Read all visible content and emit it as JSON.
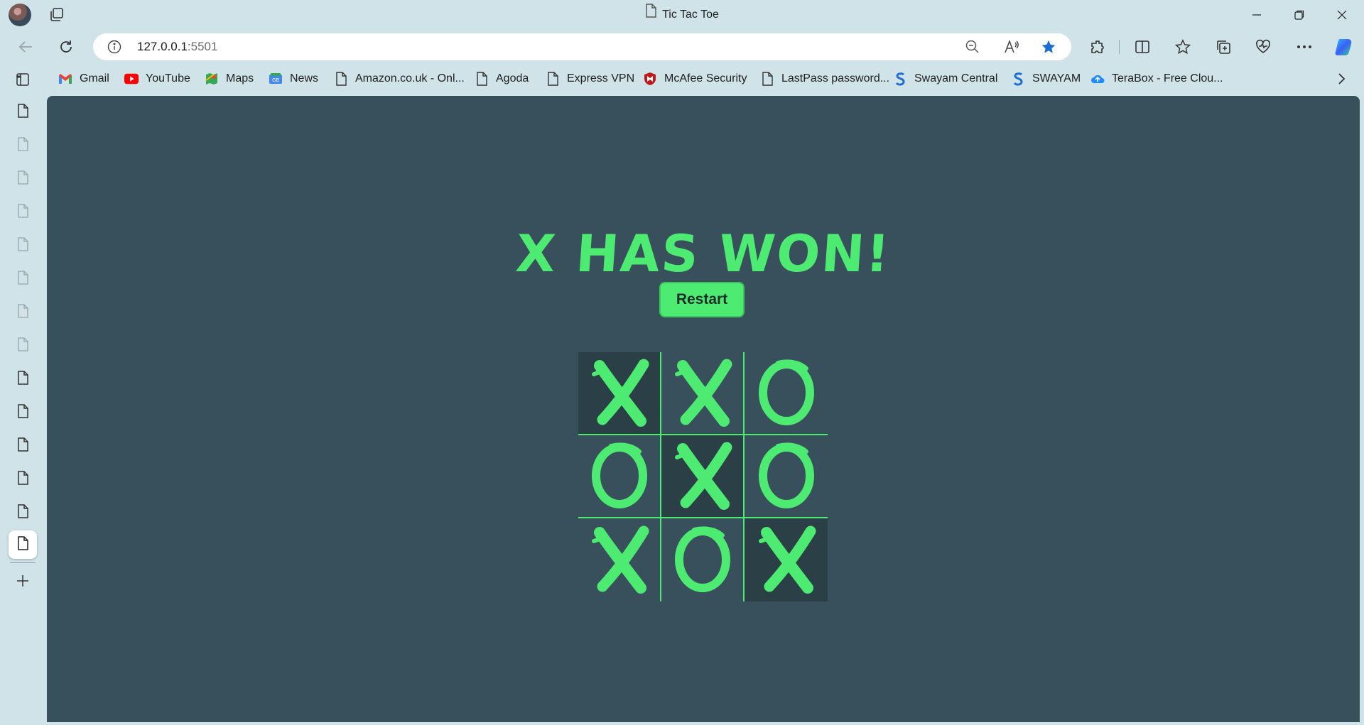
{
  "window": {
    "title": "Tic Tac Toe",
    "controls": [
      "minimize",
      "restore",
      "close"
    ]
  },
  "toolbar": {
    "address_host": "127.0.0.1",
    "address_port": ":5501"
  },
  "bookmarks": [
    {
      "label": "Gmail",
      "icon": "gmail-icon"
    },
    {
      "label": "YouTube",
      "icon": "youtube-icon"
    },
    {
      "label": "Maps",
      "icon": "maps-icon"
    },
    {
      "label": "News",
      "icon": "news-icon"
    },
    {
      "label": "Amazon.co.uk - Onl...",
      "icon": "page-icon"
    },
    {
      "label": "Agoda",
      "icon": "page-icon"
    },
    {
      "label": "Express VPN",
      "icon": "page-icon"
    },
    {
      "label": "McAfee Security",
      "icon": "mcafee-icon"
    },
    {
      "label": "LastPass password...",
      "icon": "page-icon"
    },
    {
      "label": "Swayam Central",
      "icon": "swayam-icon"
    },
    {
      "label": "SWAYAM",
      "icon": "swayam-icon"
    },
    {
      "label": "TeraBox - Free Clou...",
      "icon": "terabox-icon"
    }
  ],
  "game": {
    "status": "X HAS WON!",
    "restart_label": "Restart",
    "board": [
      "X",
      "X",
      "O",
      "O",
      "X",
      "O",
      "X",
      "O",
      "X"
    ],
    "winning_cells": [
      0,
      4,
      8
    ],
    "colors": {
      "accent": "#4deb72",
      "background": "#37505c",
      "win_cell": "#2b3f47"
    }
  }
}
